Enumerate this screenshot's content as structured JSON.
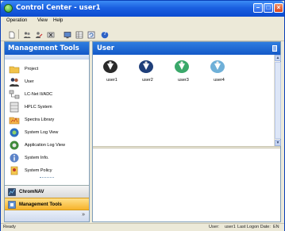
{
  "window": {
    "title": "Control Center - user1",
    "buttons": {
      "minimize": "–",
      "maximize": "□",
      "close": "×"
    }
  },
  "menu": [
    "Operation",
    "View",
    "Help"
  ],
  "toolbar": {
    "icons": [
      "new-doc-icon",
      "users-icon",
      "user-edit-icon",
      "delete-icon",
      "monitor-icon",
      "table-icon",
      "refresh-icon",
      "help-icon"
    ],
    "help_glyph": "?"
  },
  "left_panel": {
    "title": "Management Tools",
    "items": [
      {
        "label": "Project",
        "icon": "project-folder-icon"
      },
      {
        "label": "User",
        "icon": "user-icon"
      },
      {
        "label": "LC-Net II/ADC",
        "icon": "lc-net-icon"
      },
      {
        "label": "HPLC System",
        "icon": "hplc-system-icon"
      },
      {
        "label": "Spectra Library",
        "icon": "spectra-library-icon"
      },
      {
        "label": "System Log View",
        "icon": "system-log-icon"
      },
      {
        "label": "Application Log View",
        "icon": "application-log-icon"
      },
      {
        "label": "System Info.",
        "icon": "system-info-icon"
      },
      {
        "label": "System Policy",
        "icon": "system-policy-icon"
      }
    ],
    "nav_buttons": [
      {
        "label": "ChromNAV",
        "icon": "chromnav-icon"
      },
      {
        "label": "Management Tools",
        "icon": "management-tools-icon"
      }
    ],
    "overflow_chevron": "»"
  },
  "right_panel": {
    "title": "User",
    "users": [
      {
        "label": "user1",
        "icon_color": "#2a2a2a"
      },
      {
        "label": "user2",
        "icon_color": "#1f3f7a"
      },
      {
        "label": "user3",
        "icon_color": "#3aa86a"
      },
      {
        "label": "user4",
        "icon_color": "#6fb0d8"
      }
    ],
    "scroll_up": "▲",
    "scroll_down": "▼"
  },
  "status_bar": {
    "left": "Ready",
    "user_label": "User:",
    "user_value": "user1",
    "last_logon_label": "Last Logon Date:",
    "lang": "EN"
  }
}
